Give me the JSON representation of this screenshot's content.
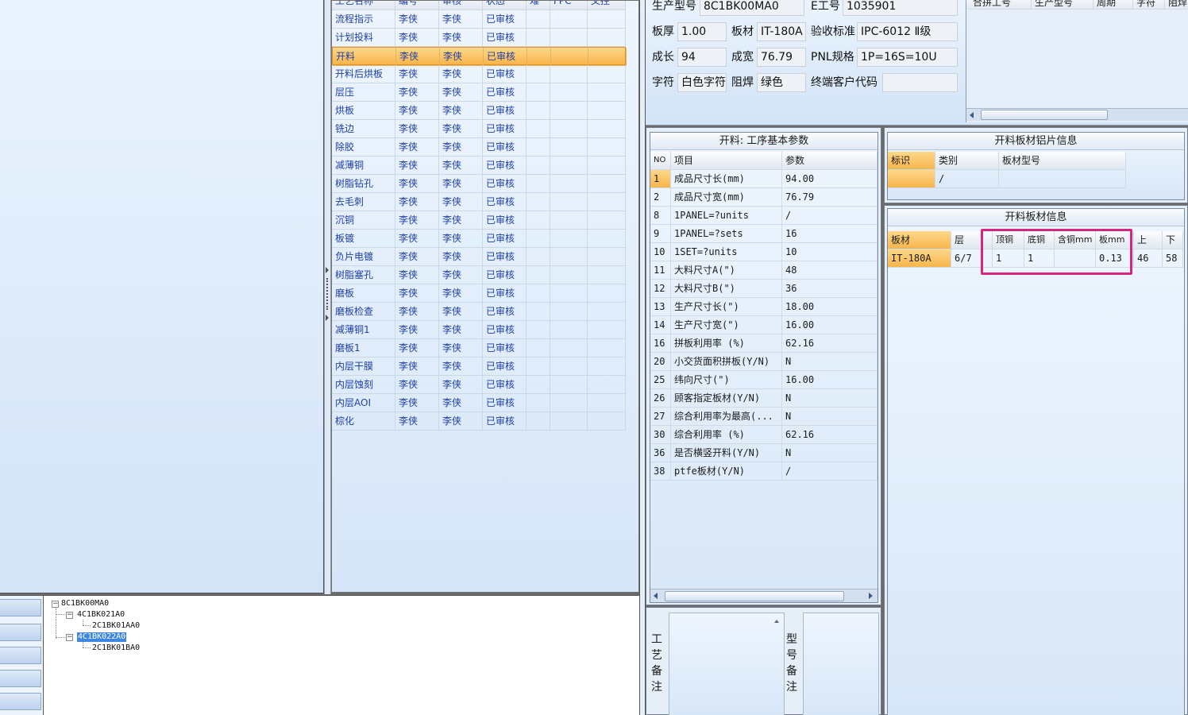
{
  "process_table": {
    "columns": [
      "工艺名称",
      "编号",
      "审核",
      "状态",
      "难",
      "FPC",
      "叉控"
    ],
    "rows": [
      {
        "name": "流程指示",
        "code": "李侠",
        "audit": "李侠",
        "status": "已审核"
      },
      {
        "name": "计划投料",
        "code": "李侠",
        "audit": "李侠",
        "status": "已审核"
      },
      {
        "name": "开料",
        "code": "李侠",
        "audit": "李侠",
        "status": "已审核",
        "selected": true
      },
      {
        "name": "开料后烘板",
        "code": "李侠",
        "audit": "李侠",
        "status": "已审核"
      },
      {
        "name": "层压",
        "code": "李侠",
        "audit": "李侠",
        "status": "已审核"
      },
      {
        "name": "烘板",
        "code": "李侠",
        "audit": "李侠",
        "status": "已审核"
      },
      {
        "name": "铣边",
        "code": "李侠",
        "audit": "李侠",
        "status": "已审核"
      },
      {
        "name": "除胶",
        "code": "李侠",
        "audit": "李侠",
        "status": "已审核"
      },
      {
        "name": "减薄铜",
        "code": "李侠",
        "audit": "李侠",
        "status": "已审核"
      },
      {
        "name": "树脂钻孔",
        "code": "李侠",
        "audit": "李侠",
        "status": "已审核"
      },
      {
        "name": "去毛刺",
        "code": "李侠",
        "audit": "李侠",
        "status": "已审核"
      },
      {
        "name": "沉铜",
        "code": "李侠",
        "audit": "李侠",
        "status": "已审核"
      },
      {
        "name": "板镀",
        "code": "李侠",
        "audit": "李侠",
        "status": "已审核"
      },
      {
        "name": "负片电镀",
        "code": "李侠",
        "audit": "李侠",
        "status": "已审核"
      },
      {
        "name": "树脂塞孔",
        "code": "李侠",
        "audit": "李侠",
        "status": "已审核"
      },
      {
        "name": "磨板",
        "code": "李侠",
        "audit": "李侠",
        "status": "已审核"
      },
      {
        "name": "磨板检查",
        "code": "李侠",
        "audit": "李侠",
        "status": "已审核"
      },
      {
        "name": "减薄铜1",
        "code": "李侠",
        "audit": "李侠",
        "status": "已审核"
      },
      {
        "name": "磨板1",
        "code": "李侠",
        "audit": "李侠",
        "status": "已审核"
      },
      {
        "name": "内层干膜",
        "code": "李侠",
        "audit": "李侠",
        "status": "已审核"
      },
      {
        "name": "内层蚀刻",
        "code": "李侠",
        "audit": "李侠",
        "status": "已审核"
      },
      {
        "name": "内层AOI",
        "code": "李侠",
        "audit": "李侠",
        "status": "已审核"
      },
      {
        "name": "棕化",
        "code": "李侠",
        "audit": "李侠",
        "status": "已审核"
      }
    ]
  },
  "product_info": {
    "model_label": "生产型号",
    "model_value": "8C1BK00MA0",
    "eno_label": "E工号",
    "eno_value": "1035901",
    "thickness_label": "板厚",
    "thickness_value": "1.00",
    "material_label": "板材",
    "material_value": "IT-180A",
    "standard_label": "验收标准",
    "standard_value": "IPC-6012 Ⅱ级",
    "length_label": "成长",
    "length_value": "94",
    "width_label": "成宽",
    "width_value": "76.79",
    "pnl_label": "PNL规格",
    "pnl_value": "1P=16S=10U",
    "char_label": "字符",
    "char_value": "白色字符",
    "mask_label": "阻焊",
    "mask_value": "绿色",
    "customer_label": "终端客户代码",
    "customer_value": ""
  },
  "merge_table": {
    "columns": [
      "合拼工号",
      "生产型号",
      "周期",
      "字符",
      "阻焊"
    ]
  },
  "params": {
    "title": "开料: 工序基本参数",
    "columns": [
      "NO",
      "项目",
      "参数"
    ],
    "rows": [
      {
        "no": "1",
        "item": "成品尺寸长(mm)",
        "value": "94.00",
        "selected": true
      },
      {
        "no": "2",
        "item": "成品尺寸宽(mm)",
        "value": "76.79"
      },
      {
        "no": "8",
        "item": "1PANEL=?units",
        "value": "/"
      },
      {
        "no": "9",
        "item": "1PANEL=?sets",
        "value": "16"
      },
      {
        "no": "10",
        "item": "1SET=?units",
        "value": "10"
      },
      {
        "no": "11",
        "item": "大料尺寸A(\")",
        "value": "48"
      },
      {
        "no": "12",
        "item": "大料尺寸B(\")",
        "value": "36"
      },
      {
        "no": "13",
        "item": "生产尺寸长(\")",
        "value": "18.00"
      },
      {
        "no": "14",
        "item": "生产尺寸宽(\")",
        "value": "16.00"
      },
      {
        "no": "16",
        "item": "拼板利用率 (%)",
        "value": "62.16"
      },
      {
        "no": "20",
        "item": "小交货面积拼板(Y/N)",
        "value": "N"
      },
      {
        "no": "25",
        "item": "纬向尺寸(\")",
        "value": "16.00"
      },
      {
        "no": "26",
        "item": "顾客指定板材(Y/N)",
        "value": "N"
      },
      {
        "no": "27",
        "item": "综合利用率为最高(...",
        "value": "N"
      },
      {
        "no": "30",
        "item": "综合利用率 (%)",
        "value": "62.16"
      },
      {
        "no": "36",
        "item": "是否横竖开料(Y/N)",
        "value": "N"
      },
      {
        "no": "38",
        "item": "ptfe板材(Y/N)",
        "value": "/"
      }
    ]
  },
  "foil_info": {
    "title": "开料板材铝片信息",
    "columns": [
      "标识",
      "类别",
      "板材型号"
    ],
    "rows": [
      {
        "mark": "",
        "type": "/",
        "model": ""
      }
    ]
  },
  "board_info": {
    "title": "开料板材信息",
    "columns": [
      "板材",
      "层",
      "顶铜",
      "底铜",
      "含铜mm",
      "板mm",
      "上",
      "下"
    ],
    "rows": [
      {
        "material": "IT-180A",
        "layer": "6/7",
        "top": "1",
        "bottom": "1",
        "cu_mm": "",
        "board_mm": "0.13",
        "up": "46",
        "down": "58"
      }
    ]
  },
  "remarks": {
    "process_label": "工艺备注",
    "model_label": "型号备注"
  },
  "tree": {
    "root": "8C1BK00MA0",
    "child1": "4C1BK021A0",
    "child1_leaf": "2C1BK01AA0",
    "child2": "4C1BK022A0",
    "child2_leaf": "2C1BK01BA0"
  },
  "colors": {
    "highlight_box": "#d6257f",
    "selected_row": "#f7b54c",
    "link_text": "#1e3fa8"
  }
}
